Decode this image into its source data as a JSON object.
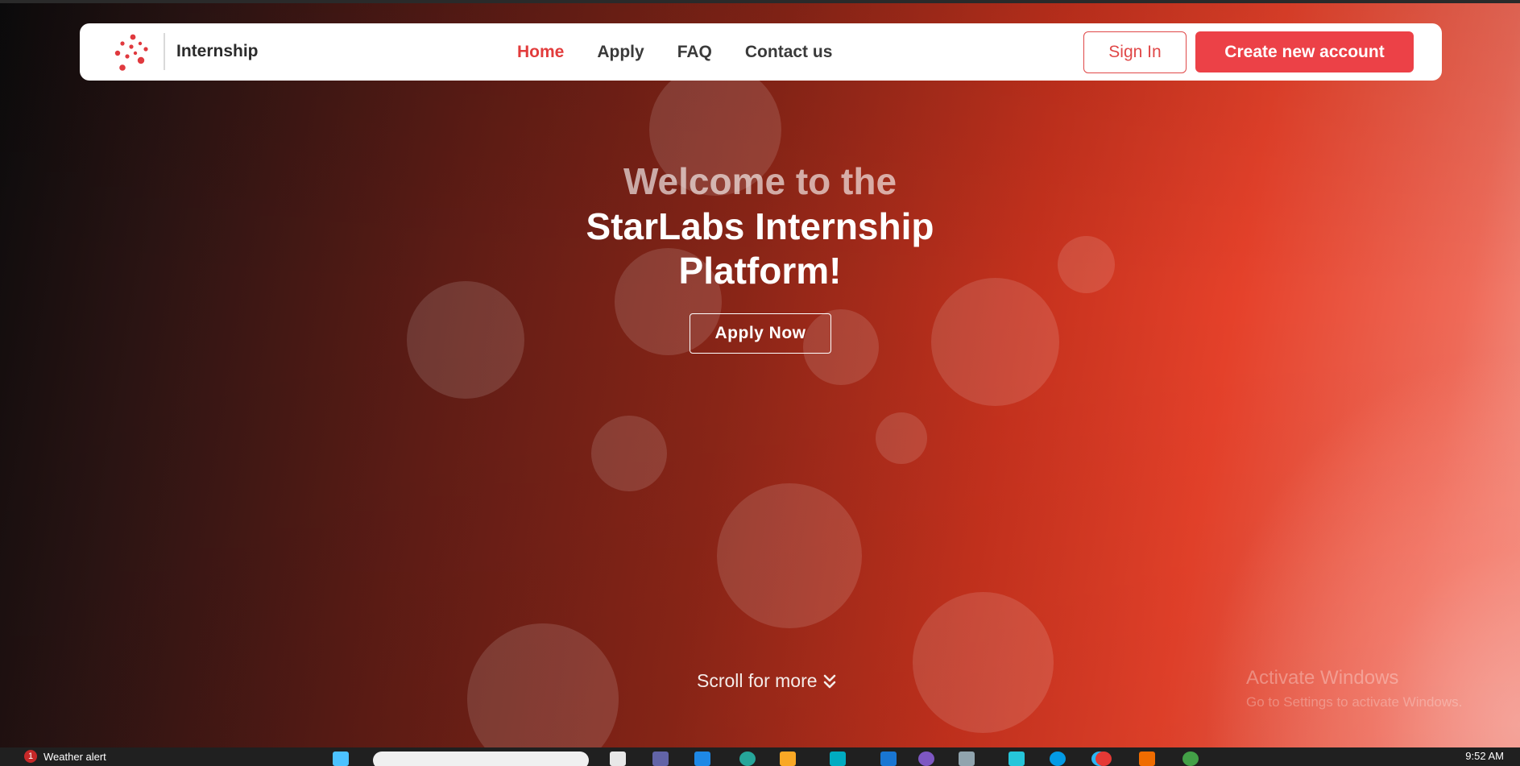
{
  "navbar": {
    "brand": "Internship",
    "links": [
      {
        "label": "Home",
        "active": true
      },
      {
        "label": "Apply",
        "active": false
      },
      {
        "label": "FAQ",
        "active": false
      },
      {
        "label": "Contact us",
        "active": false
      }
    ],
    "sign_in_label": "Sign In",
    "create_account_label": "Create new account"
  },
  "hero": {
    "welcome_pre": "Welcome to the",
    "title_line1": "StarLabs Internship",
    "title_line2": "Platform!",
    "apply_button": "Apply Now",
    "scroll_text": "Scroll for more",
    "scroll_icon": "double-chevron-down-icon"
  },
  "watermark": {
    "line1": "Activate Windows",
    "line2": "Go to Settings to activate Windows."
  },
  "taskbar": {
    "notification_count": "1",
    "weather_text": "Weather alert",
    "clock": "9:52 AM"
  },
  "colors": {
    "accent": "#ec4147",
    "active_link": "#e23c3c",
    "hero_dark": "#0b0b0c",
    "hero_red": "#e5412a",
    "hero_light": "#f49a8e"
  }
}
